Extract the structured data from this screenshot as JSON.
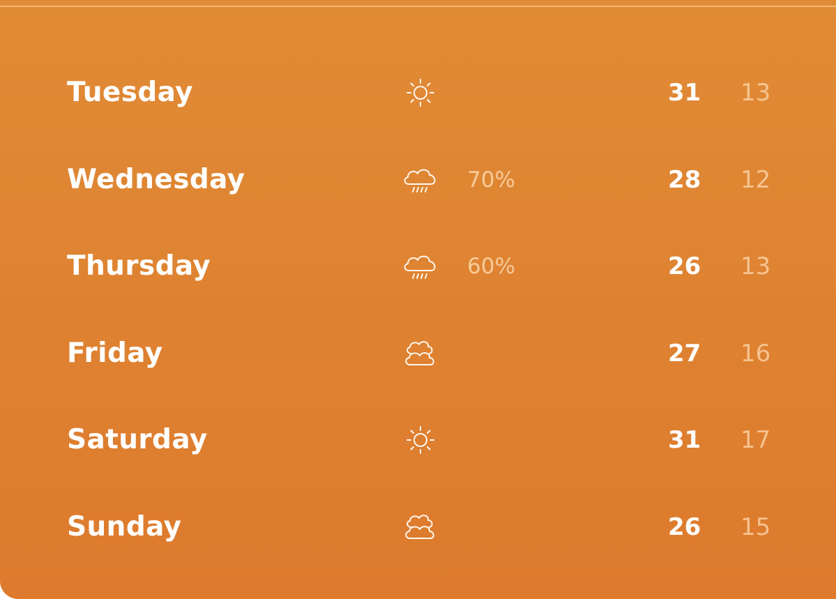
{
  "forecast": {
    "days": [
      {
        "day": "Tuesday",
        "icon": "sun-icon",
        "precip": "",
        "high": "31",
        "low": "13"
      },
      {
        "day": "Wednesday",
        "icon": "rain-cloud-icon",
        "precip": "70%",
        "high": "28",
        "low": "12"
      },
      {
        "day": "Thursday",
        "icon": "rain-cloud-icon",
        "precip": "60%",
        "high": "26",
        "low": "13"
      },
      {
        "day": "Friday",
        "icon": "clouds-icon",
        "precip": "",
        "high": "27",
        "low": "16"
      },
      {
        "day": "Saturday",
        "icon": "sun-icon",
        "precip": "",
        "high": "31",
        "low": "17"
      },
      {
        "day": "Sunday",
        "icon": "clouds-icon",
        "precip": "",
        "high": "26",
        "low": "15"
      }
    ]
  },
  "colors": {
    "panel_top": "#e08b36",
    "panel_bottom": "#dd7a2d",
    "text_primary": "#ffffff",
    "text_muted": "#ffdcb4"
  }
}
